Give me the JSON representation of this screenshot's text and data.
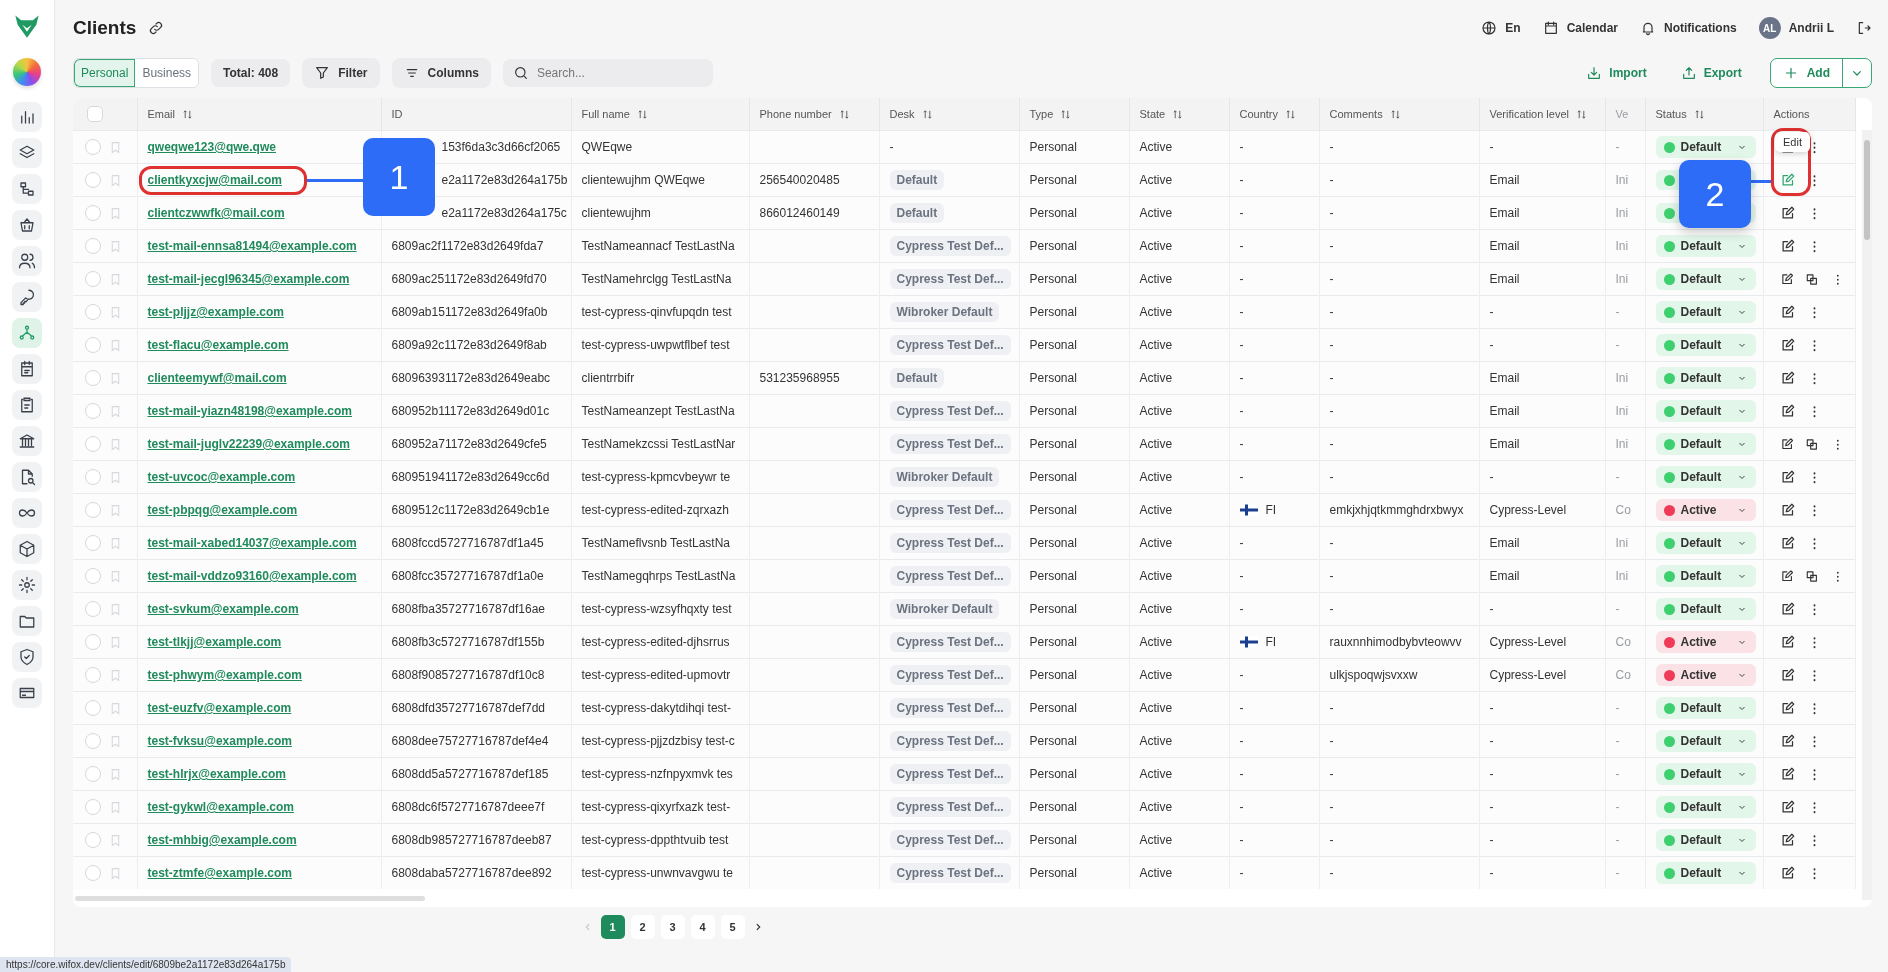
{
  "sidebar": {
    "items": [
      {
        "selected": false
      },
      {
        "selected": false
      },
      {
        "selected": false
      },
      {
        "selected": false
      },
      {
        "selected": false
      },
      {
        "selected": false
      },
      {
        "selected": true
      },
      {
        "selected": false
      },
      {
        "selected": false
      },
      {
        "selected": false
      },
      {
        "selected": false
      },
      {
        "selected": false
      },
      {
        "selected": false
      },
      {
        "selected": false
      },
      {
        "selected": false
      },
      {
        "selected": false
      },
      {
        "selected": false
      }
    ]
  },
  "page": {
    "title": "Clients"
  },
  "top_bar": {
    "language": "En",
    "calendar": "Calendar",
    "notifications": "Notifications",
    "avatar_initials": "AL",
    "user_name": "Andrii L"
  },
  "toolbar": {
    "segments": [
      {
        "label": "Personal",
        "selected": true
      },
      {
        "label": "Business",
        "selected": false
      }
    ],
    "total": "Total: 408",
    "filter": "Filter",
    "columns": "Columns",
    "search": {
      "placeholder": "Search..."
    },
    "import": "Import",
    "export": "Export",
    "add": "Add"
  },
  "table": {
    "select_all": {
      "checked": false
    },
    "columns": [
      {
        "label": "Email",
        "sortable": true
      },
      {
        "label": "ID",
        "sortable": false
      },
      {
        "label": "Full name",
        "sortable": true
      },
      {
        "label": "Phone number",
        "sortable": true
      },
      {
        "label": "Desk",
        "sortable": true
      },
      {
        "label": "Type",
        "sortable": true
      },
      {
        "label": "State",
        "sortable": true
      },
      {
        "label": "Country",
        "sortable": true
      },
      {
        "label": "Comments",
        "sortable": true
      },
      {
        "label": "Verification level",
        "sortable": true
      },
      {
        "label": "Ve",
        "sortable": false
      },
      {
        "label": "Status",
        "sortable": true
      },
      {
        "label": "Actions",
        "sortable": false
      }
    ],
    "rows": [
      {
        "checked": false,
        "email": "qweqwe123@qwe.qwe",
        "id": "153f6da3c3d66cf2065",
        "name": "QWEqwe",
        "desk": {
          "label": "-",
          "kind": "plain"
        },
        "type": "Personal",
        "state": "Active",
        "country": {
          "code": "-",
          "flag": false
        },
        "comments": "-",
        "verification": "-",
        "column_11": "-",
        "status": {
          "label": "Default",
          "color": "#3ecf6e"
        },
        "actions": [
          {
            "kind": "edit"
          },
          {
            "kind": "more"
          }
        ],
        "edit_highlighted": false
      },
      {
        "checked": false,
        "email": "clientkyxcjw@mail.com",
        "id": "e2a1172e83d264a175b",
        "name": "clientewujhm QWEqwe",
        "phone": "256540020485",
        "desk": {
          "label": "Default",
          "kind": "chip"
        },
        "type": "Personal",
        "state": "Active",
        "country": {
          "code": "-",
          "flag": false
        },
        "comments": "-",
        "verification": "Email",
        "column_11": "Ini",
        "status": {
          "color": "#3ecf6e"
        },
        "actions": [
          {
            "kind": "edit"
          },
          {
            "kind": "more"
          }
        ],
        "edit_highlighted": true
      },
      {
        "checked": false,
        "email": "clientczwwfk@mail.com",
        "id": "e2a1172e83d264a175c",
        "name": "clientewujhm",
        "phone": "866012460149",
        "desk": {
          "label": "Default",
          "kind": "chip"
        },
        "type": "Personal",
        "state": "Active",
        "country": {
          "code": "-",
          "flag": false
        },
        "comments": "-",
        "verification": "Email",
        "column_11": "Ini",
        "status": {
          "color": "#3ecf6e"
        },
        "actions": [
          {
            "kind": "edit"
          },
          {
            "kind": "more"
          }
        ],
        "edit_highlighted": false
      },
      {
        "checked": false,
        "email": "test-mail-ennsa81494@example.com",
        "id": "6809ac2f1172e83d2649fda7",
        "name": "TestNameannacf TestLastNa",
        "desk": {
          "label": "Cypress Test Def...",
          "kind": "chip"
        },
        "type": "Personal",
        "state": "Active",
        "country": {
          "code": "-",
          "flag": false
        },
        "comments": "-",
        "verification": "Email",
        "column_11": "Ini",
        "status": {
          "label": "Default",
          "color": "#3ecf6e"
        },
        "actions": [
          {
            "kind": "edit"
          },
          {
            "kind": "more"
          }
        ],
        "edit_highlighted": false
      },
      {
        "checked": false,
        "email": "test-mail-jecgl96345@example.com",
        "id": "6809ac251172e83d2649fd70",
        "name": "TestNamehrclgg TestLastNa",
        "desk": {
          "label": "Cypress Test Def...",
          "kind": "chip"
        },
        "type": "Personal",
        "state": "Active",
        "country": {
          "code": "-",
          "flag": false
        },
        "comments": "-",
        "verification": "Email",
        "column_11": "Ini",
        "status": {
          "label": "Default",
          "color": "#3ecf6e"
        },
        "actions": [
          {
            "kind": "edit"
          },
          {
            "kind": "copy"
          },
          {
            "kind": "more"
          }
        ],
        "edit_highlighted": false
      },
      {
        "checked": false,
        "email": "test-pljjz@example.com",
        "id": "6809ab151172e83d2649fa0b",
        "name": "test-cypress-qinvfupqdn test",
        "desk": {
          "label": "Wibroker Default",
          "kind": "chip"
        },
        "type": "Personal",
        "state": "Active",
        "country": {
          "code": "-",
          "flag": false
        },
        "comments": "-",
        "verification": "-",
        "column_11": "-",
        "status": {
          "label": "Default",
          "color": "#3ecf6e"
        },
        "actions": [
          {
            "kind": "edit"
          },
          {
            "kind": "more"
          }
        ],
        "edit_highlighted": false
      },
      {
        "checked": false,
        "email": "test-flacu@example.com",
        "id": "6809a92c1172e83d2649f8ab",
        "name": "test-cypress-uwpwtflbef test",
        "desk": {
          "label": "Cypress Test Def...",
          "kind": "chip"
        },
        "type": "Personal",
        "state": "Active",
        "country": {
          "code": "-",
          "flag": false
        },
        "comments": "-",
        "verification": "-",
        "column_11": "-",
        "status": {
          "label": "Default",
          "color": "#3ecf6e"
        },
        "actions": [
          {
            "kind": "edit"
          },
          {
            "kind": "more"
          }
        ],
        "edit_highlighted": false
      },
      {
        "checked": false,
        "email": "clienteemywf@mail.com",
        "id": "680963931172e83d2649eabc",
        "name": "clientrrbifr",
        "phone": "531235968955",
        "desk": {
          "label": "Default",
          "kind": "chip"
        },
        "type": "Personal",
        "state": "Active",
        "country": {
          "code": "-",
          "flag": false
        },
        "comments": "-",
        "verification": "Email",
        "column_11": "Ini",
        "status": {
          "label": "Default",
          "color": "#3ecf6e"
        },
        "actions": [
          {
            "kind": "edit"
          },
          {
            "kind": "more"
          }
        ],
        "edit_highlighted": false
      },
      {
        "checked": false,
        "email": "test-mail-yiazn48198@example.com",
        "id": "680952b11172e83d2649d01c",
        "name": "TestNameanzept TestLastNa",
        "desk": {
          "label": "Cypress Test Def...",
          "kind": "chip"
        },
        "type": "Personal",
        "state": "Active",
        "country": {
          "code": "-",
          "flag": false
        },
        "comments": "-",
        "verification": "Email",
        "column_11": "Ini",
        "status": {
          "label": "Default",
          "color": "#3ecf6e"
        },
        "actions": [
          {
            "kind": "edit"
          },
          {
            "kind": "more"
          }
        ],
        "edit_highlighted": false
      },
      {
        "checked": false,
        "email": "test-mail-juglv22239@example.com",
        "id": "680952a71172e83d2649cfe5",
        "name": "TestNamekzcssi TestLastNar",
        "desk": {
          "label": "Cypress Test Def...",
          "kind": "chip"
        },
        "type": "Personal",
        "state": "Active",
        "country": {
          "code": "-",
          "flag": false
        },
        "comments": "-",
        "verification": "Email",
        "column_11": "Ini",
        "status": {
          "label": "Default",
          "color": "#3ecf6e"
        },
        "actions": [
          {
            "kind": "edit"
          },
          {
            "kind": "copy"
          },
          {
            "kind": "more"
          }
        ],
        "edit_highlighted": false
      },
      {
        "checked": false,
        "email": "test-uvcoc@example.com",
        "id": "680951941172e83d2649cc6d",
        "name": "test-cypress-kpmcvbeywr te",
        "desk": {
          "label": "Wibroker Default",
          "kind": "chip"
        },
        "type": "Personal",
        "state": "Active",
        "country": {
          "code": "-",
          "flag": false
        },
        "comments": "-",
        "verification": "-",
        "column_11": "-",
        "status": {
          "label": "Default",
          "color": "#3ecf6e"
        },
        "actions": [
          {
            "kind": "edit"
          },
          {
            "kind": "more"
          }
        ],
        "edit_highlighted": false
      },
      {
        "checked": false,
        "email": "test-pbpqg@example.com",
        "id": "6809512c1172e83d2649cb1e",
        "name": "test-cypress-edited-zqrxazh",
        "desk": {
          "label": "Cypress Test Def...",
          "kind": "chip"
        },
        "type": "Personal",
        "state": "Active",
        "country": {
          "code": "FI",
          "flag": true
        },
        "comments": "emkjxhjqtkmmghdrxbwyx",
        "verification": "Cypress-Level",
        "column_11": "Co",
        "status": {
          "label": "Active",
          "color": "#ef3b57"
        },
        "actions": [
          {
            "kind": "edit"
          },
          {
            "kind": "more"
          }
        ],
        "edit_highlighted": false
      },
      {
        "checked": false,
        "email": "test-mail-xabed14037@example.com",
        "id": "6808fccd5727716787df1a45",
        "name": "TestNameflvsnb TestLastNa",
        "desk": {
          "label": "Cypress Test Def...",
          "kind": "chip"
        },
        "type": "Personal",
        "state": "Active",
        "country": {
          "code": "-",
          "flag": false
        },
        "comments": "-",
        "verification": "Email",
        "column_11": "Ini",
        "status": {
          "label": "Default",
          "color": "#3ecf6e"
        },
        "actions": [
          {
            "kind": "edit"
          },
          {
            "kind": "more"
          }
        ],
        "edit_highlighted": false
      },
      {
        "checked": false,
        "email": "test-mail-vddzo93160@example.com",
        "id": "6808fcc35727716787df1a0e",
        "name": "TestNamegqhrps TestLastNa",
        "desk": {
          "label": "Cypress Test Def...",
          "kind": "chip"
        },
        "type": "Personal",
        "state": "Active",
        "country": {
          "code": "-",
          "flag": false
        },
        "comments": "-",
        "verification": "Email",
        "column_11": "Ini",
        "status": {
          "label": "Default",
          "color": "#3ecf6e"
        },
        "actions": [
          {
            "kind": "edit"
          },
          {
            "kind": "copy"
          },
          {
            "kind": "more"
          }
        ],
        "edit_highlighted": false
      },
      {
        "checked": false,
        "email": "test-svkum@example.com",
        "id": "6808fba35727716787df16ae",
        "name": "test-cypress-wzsyfhqxty test",
        "desk": {
          "label": "Wibroker Default",
          "kind": "chip"
        },
        "type": "Personal",
        "state": "Active",
        "country": {
          "code": "-",
          "flag": false
        },
        "comments": "-",
        "verification": "-",
        "column_11": "-",
        "status": {
          "label": "Default",
          "color": "#3ecf6e"
        },
        "actions": [
          {
            "kind": "edit"
          },
          {
            "kind": "more"
          }
        ],
        "edit_highlighted": false
      },
      {
        "checked": false,
        "email": "test-tlkjj@example.com",
        "id": "6808fb3c5727716787df155b",
        "name": "test-cypress-edited-djhsrrus",
        "desk": {
          "label": "Cypress Test Def...",
          "kind": "chip"
        },
        "type": "Personal",
        "state": "Active",
        "country": {
          "code": "FI",
          "flag": true
        },
        "comments": "rauxnnhimodbybvteowvv",
        "verification": "Cypress-Level",
        "column_11": "Co",
        "status": {
          "label": "Active",
          "color": "#ef3b57"
        },
        "actions": [
          {
            "kind": "edit"
          },
          {
            "kind": "more"
          }
        ],
        "edit_highlighted": false
      },
      {
        "checked": false,
        "email": "test-phwym@example.com",
        "id": "6808f9085727716787df10c8",
        "name": "test-cypress-edited-upmovtr",
        "desk": {
          "label": "Cypress Test Def...",
          "kind": "chip"
        },
        "type": "Personal",
        "state": "Active",
        "country": {
          "code": "-",
          "flag": false
        },
        "comments": "ulkjspoqwjsvxxw",
        "verification": "Cypress-Level",
        "column_11": "Co",
        "status": {
          "label": "Active",
          "color": "#ef3b57"
        },
        "actions": [
          {
            "kind": "edit"
          },
          {
            "kind": "more"
          }
        ],
        "edit_highlighted": false
      },
      {
        "checked": false,
        "email": "test-euzfv@example.com",
        "id": "6808dfd35727716787def7dd",
        "name": "test-cypress-dakytdihqi test-",
        "desk": {
          "label": "Cypress Test Def...",
          "kind": "chip"
        },
        "type": "Personal",
        "state": "Active",
        "country": {
          "code": "-",
          "flag": false
        },
        "comments": "-",
        "verification": "-",
        "column_11": "-",
        "status": {
          "label": "Default",
          "color": "#3ecf6e"
        },
        "actions": [
          {
            "kind": "edit"
          },
          {
            "kind": "more"
          }
        ],
        "edit_highlighted": false
      },
      {
        "checked": false,
        "email": "test-fvksu@example.com",
        "id": "6808dee75727716787def4e4",
        "name": "test-cypress-pjjzdzbisy test-c",
        "desk": {
          "label": "Cypress Test Def...",
          "kind": "chip"
        },
        "type": "Personal",
        "state": "Active",
        "country": {
          "code": "-",
          "flag": false
        },
        "comments": "-",
        "verification": "-",
        "column_11": "-",
        "status": {
          "label": "Default",
          "color": "#3ecf6e"
        },
        "actions": [
          {
            "kind": "edit"
          },
          {
            "kind": "more"
          }
        ],
        "edit_highlighted": false
      },
      {
        "checked": false,
        "email": "test-hlrjx@example.com",
        "id": "6808dd5a5727716787def185",
        "name": "test-cypress-nzfnpyxmvk tes",
        "desk": {
          "label": "Cypress Test Def...",
          "kind": "chip"
        },
        "type": "Personal",
        "state": "Active",
        "country": {
          "code": "-",
          "flag": false
        },
        "comments": "-",
        "verification": "-",
        "column_11": "-",
        "status": {
          "label": "Default",
          "color": "#3ecf6e"
        },
        "actions": [
          {
            "kind": "edit"
          },
          {
            "kind": "more"
          }
        ],
        "edit_highlighted": false
      },
      {
        "checked": false,
        "email": "test-gykwl@example.com",
        "id": "6808dc6f5727716787deee7f",
        "name": "test-cypress-qixyrfxazk test-",
        "desk": {
          "label": "Cypress Test Def...",
          "kind": "chip"
        },
        "type": "Personal",
        "state": "Active",
        "country": {
          "code": "-",
          "flag": false
        },
        "comments": "-",
        "verification": "-",
        "column_11": "-",
        "status": {
          "label": "Default",
          "color": "#3ecf6e"
        },
        "actions": [
          {
            "kind": "edit"
          },
          {
            "kind": "more"
          }
        ],
        "edit_highlighted": false
      },
      {
        "checked": false,
        "email": "test-mhbig@example.com",
        "id": "6808db985727716787deeb87",
        "name": "test-cypress-dppthtvuib test",
        "desk": {
          "label": "Cypress Test Def...",
          "kind": "chip"
        },
        "type": "Personal",
        "state": "Active",
        "country": {
          "code": "-",
          "flag": false
        },
        "comments": "-",
        "verification": "-",
        "column_11": "-",
        "status": {
          "label": "Default",
          "color": "#3ecf6e"
        },
        "actions": [
          {
            "kind": "edit"
          },
          {
            "kind": "more"
          }
        ],
        "edit_highlighted": false
      },
      {
        "checked": false,
        "email": "test-ztmfe@example.com",
        "id": "6808daba5727716787dee892",
        "name": "test-cypress-unwnvavgwu te",
        "desk": {
          "label": "Cypress Test Def...",
          "kind": "chip"
        },
        "type": "Personal",
        "state": "Active",
        "country": {
          "code": "-",
          "flag": false
        },
        "comments": "-",
        "verification": "-",
        "column_11": "-",
        "status": {
          "label": "Default",
          "color": "#3ecf6e"
        },
        "actions": [
          {
            "kind": "edit"
          },
          {
            "kind": "more"
          }
        ],
        "edit_highlighted": false
      }
    ]
  },
  "annotations": {
    "callouts": [
      {
        "label": "1"
      },
      {
        "label": "2"
      }
    ],
    "tooltip": "Edit"
  },
  "pagination": {
    "pages": [
      {
        "label": "1",
        "selected": true
      },
      {
        "label": "2",
        "selected": false
      },
      {
        "label": "3",
        "selected": false
      },
      {
        "label": "4",
        "selected": false
      },
      {
        "label": "5",
        "selected": false
      }
    ],
    "prev_disabled": true
  },
  "browser_status_url": "https://core.wifox.dev/clients/edit/6809be2a1172e83d264a175b"
}
